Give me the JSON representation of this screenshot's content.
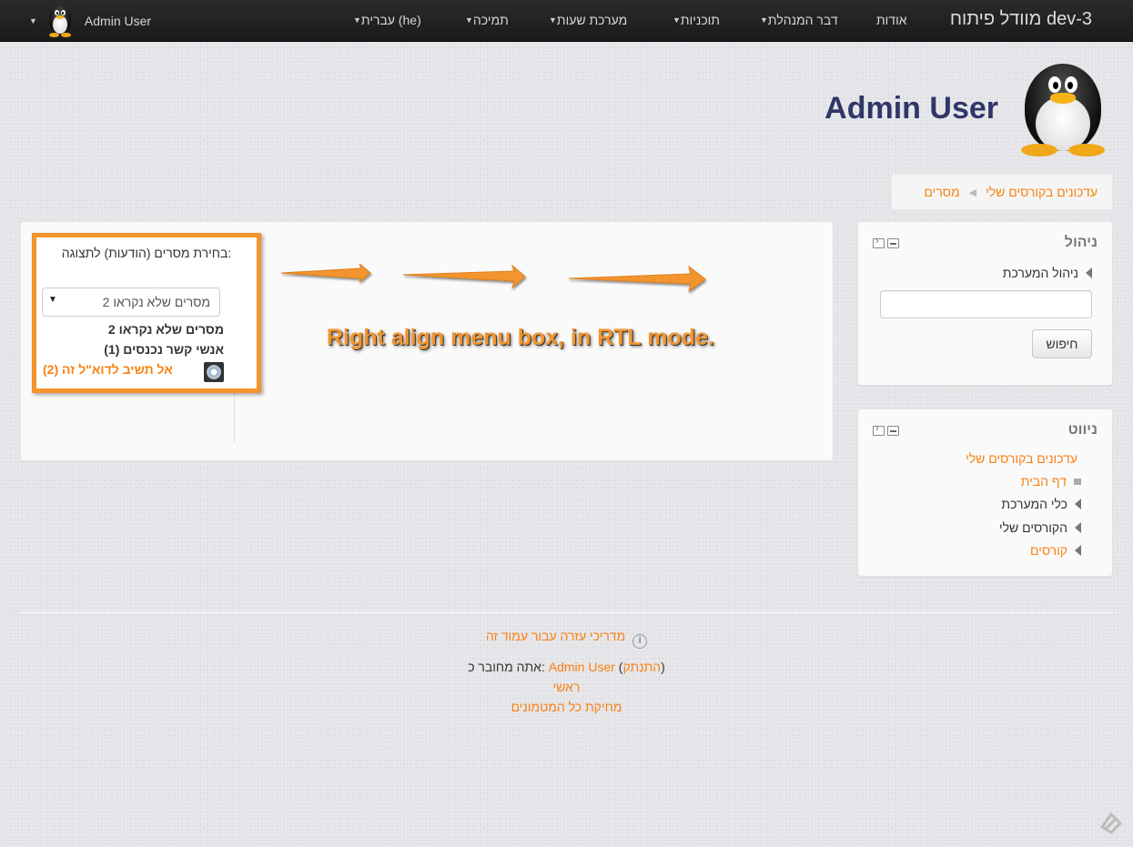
{
  "navbar": {
    "brand": "מוודל פיתוח dev-3",
    "items": [
      {
        "label": "אודות"
      },
      {
        "label": "דבר המנהלת"
      },
      {
        "label": "תוכניות"
      },
      {
        "label": "מערכת שעות"
      },
      {
        "label": "תמיכה"
      },
      {
        "label": "עברית (he)"
      }
    ],
    "user_name": "Admin User"
  },
  "header": {
    "title": "Admin User"
  },
  "breadcrumb": [
    {
      "label": "עדכונים בקורסים שלי"
    },
    {
      "label": "מסרים"
    }
  ],
  "admin_block": {
    "title": "ניהול",
    "site_admin": "ניהול המערכת",
    "search_placeholder": "",
    "search_button": "חיפוש"
  },
  "nav_block": {
    "title": "ניווט",
    "items": [
      {
        "label": "עדכונים בקורסים שלי"
      },
      {
        "label": "דף הבית"
      },
      {
        "label": "כלי המערכת"
      },
      {
        "label": "הקורסים שלי"
      },
      {
        "label": "קורסים"
      }
    ]
  },
  "messages": {
    "select_label": "בחירת מסרים (הודעות) לתצוגה:",
    "select_value": "2 מסרים שלא נקראו",
    "unread_heading": "2 מסרים שלא נקראו",
    "contacts_heading": "אנשי קשר נכנסים (1)",
    "contact_name": "אל תשיב לדוא\"ל זה (2)"
  },
  "annotation": "Right align menu box, in RTL mode.",
  "footer": {
    "help_link": "מדריכי עזרה עבור עמוד זה",
    "logged_in_prefix": "אתה מחובר כ:",
    "logged_in_user": "Admin User",
    "logout": "התנתק",
    "home": "ראשי",
    "purge": "מחיקת כל המטמונים"
  },
  "colors": {
    "accent": "#f98012",
    "highlight": "#f3942d",
    "navbar": "#222222",
    "title": "#2f3768"
  }
}
